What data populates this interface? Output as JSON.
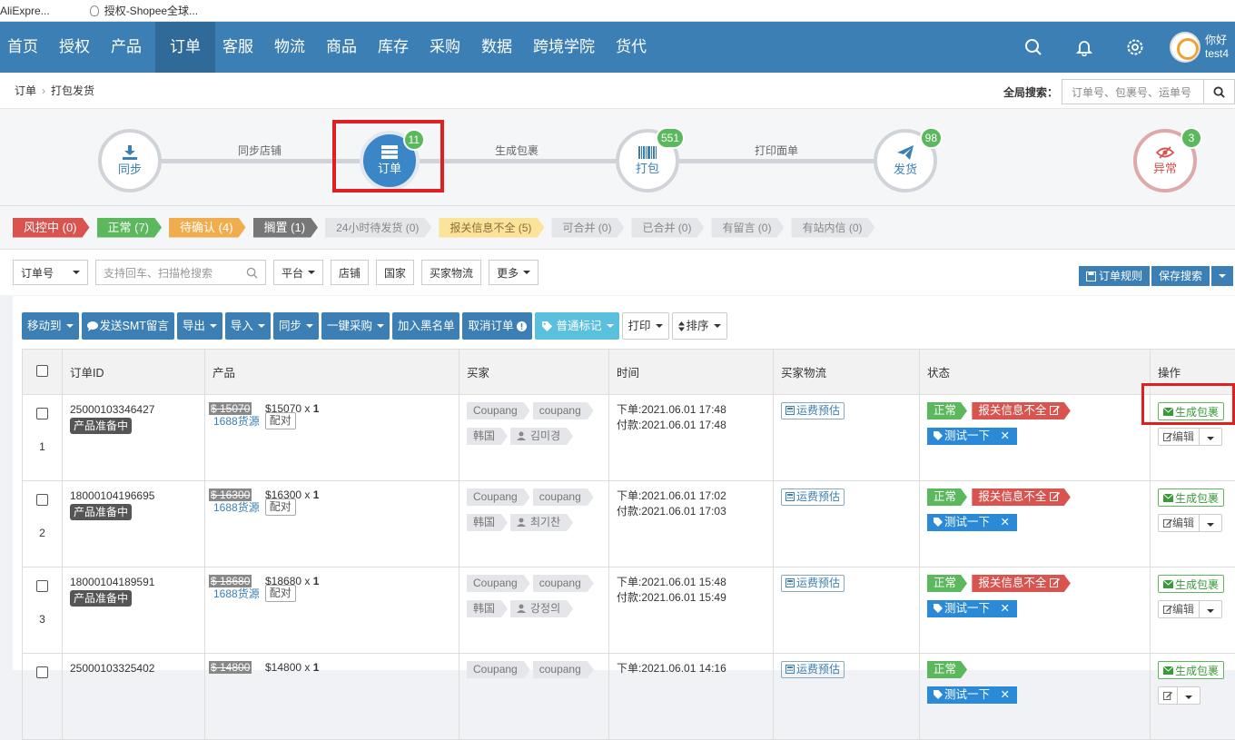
{
  "bookmarks": [
    "AliExpre...",
    "授权-Shopee全球..."
  ],
  "nav": {
    "items": [
      "首页",
      "授权",
      "产品",
      "订单",
      "客服",
      "物流",
      "商品",
      "库存",
      "采购",
      "数据",
      "跨境学院",
      "货代"
    ],
    "active_index": 3,
    "user_greeting": "你好",
    "user_name": "test4"
  },
  "breadcrumb": [
    "订单",
    "打包发货"
  ],
  "global_search": {
    "label": "全局搜索：",
    "placeholder": "订单号、包裹号、运单号"
  },
  "flow": {
    "steps": [
      {
        "label": "同步",
        "badge": ""
      },
      {
        "label": "订单",
        "badge": "11"
      },
      {
        "label": "打包",
        "badge": "551"
      },
      {
        "label": "发货",
        "badge": "98"
      },
      {
        "label": "异常",
        "badge": "3"
      }
    ],
    "connectors": [
      "同步店铺",
      "生成包裹",
      "打印面单"
    ]
  },
  "filter_tags": [
    {
      "label": "风控中 (0)",
      "style": "red"
    },
    {
      "label": "正常 (7)",
      "style": "green"
    },
    {
      "label": "待确认 (4)",
      "style": "orange"
    },
    {
      "label": "搁置 (1)",
      "style": "gray"
    },
    {
      "label": "24小时待发货 (0)",
      "style": "light"
    },
    {
      "label": "报关信息不全 (5)",
      "style": "yellow"
    },
    {
      "label": "可合并 (0)",
      "style": "light"
    },
    {
      "label": "已合并 (0)",
      "style": "light"
    },
    {
      "label": "有留言 (0)",
      "style": "light"
    },
    {
      "label": "有站内信 (0)",
      "style": "light"
    }
  ],
  "search_row": {
    "field_select": "订单号",
    "scan_placeholder": "支持回车、扫描枪搜索",
    "buttons": [
      "平台",
      "店铺",
      "国家",
      "买家物流",
      "更多"
    ],
    "order_rules": "订单规则",
    "save_search": "保存搜索"
  },
  "toolbar": [
    "移动到",
    "发送SMT留言",
    "导出",
    "导入",
    "同步",
    "一键采购",
    "加入黑名单",
    "取消订单",
    "普通标记",
    "打印",
    "排序"
  ],
  "table": {
    "headers": [
      "订单ID",
      "产品",
      "买家",
      "时间",
      "买家物流",
      "状态",
      "操作"
    ],
    "rows": [
      {
        "idx": "1",
        "order_id": "25000103346427",
        "prep": "产品准备中",
        "img_price": "$ 15070",
        "price": "$15070 x ",
        "qty": "1",
        "source": "1688货源",
        "match": "配对",
        "platform": "Coupang",
        "shop": "coupang",
        "country": "韩国",
        "buyer": "김미경",
        "order_time": "下单:2021.06.01 17:48",
        "pay_time": "付款:2021.06.01 17:48",
        "ship_est": "运费预估",
        "status_ok": "正常",
        "status_warn": "报关信息不全",
        "mark": "测试一下",
        "gen": "生成包裹",
        "edit": "编辑"
      },
      {
        "idx": "2",
        "order_id": "18000104196695",
        "prep": "产品准备中",
        "img_price": "$ 16300",
        "price": "$16300 x ",
        "qty": "1",
        "source": "1688货源",
        "match": "配对",
        "platform": "Coupang",
        "shop": "coupang",
        "country": "韩国",
        "buyer": "최기찬",
        "order_time": "下单:2021.06.01 17:02",
        "pay_time": "付款:2021.06.01 17:03",
        "ship_est": "运费预估",
        "status_ok": "正常",
        "status_warn": "报关信息不全",
        "mark": "测试一下",
        "gen": "生成包裹",
        "edit": "编辑"
      },
      {
        "idx": "3",
        "order_id": "18000104189591",
        "prep": "产品准备中",
        "img_price": "$ 18680",
        "price": "$18680 x ",
        "qty": "1",
        "source": "1688货源",
        "match": "配对",
        "platform": "Coupang",
        "shop": "coupang",
        "country": "韩国",
        "buyer": "강정의",
        "order_time": "下单:2021.06.01 15:48",
        "pay_time": "付款:2021.06.01 15:49",
        "ship_est": "运费预估",
        "status_ok": "正常",
        "status_warn": "报关信息不全",
        "mark": "测试一下",
        "gen": "生成包裹",
        "edit": "编辑"
      },
      {
        "idx": "",
        "order_id": "25000103325402",
        "prep": "",
        "img_price": "$ 14800",
        "price": "$14800 x ",
        "qty": "1",
        "source": "",
        "match": "",
        "platform": "Coupang",
        "shop": "coupang",
        "country": "",
        "buyer": "",
        "order_time": "下单:2021.06.01 14:16",
        "pay_time": "",
        "ship_est": "运费预估",
        "status_ok": "正常",
        "status_warn": "",
        "mark": "测试一下",
        "gen": "生成包裹",
        "edit": ""
      }
    ]
  }
}
